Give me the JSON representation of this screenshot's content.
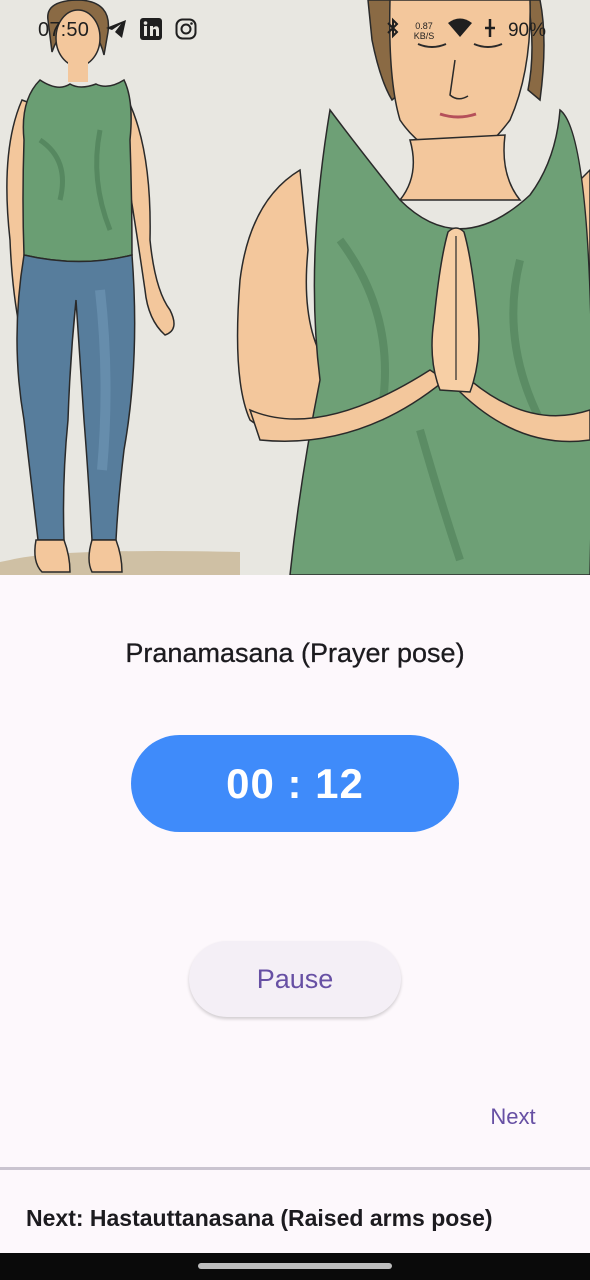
{
  "status_bar": {
    "time": "07:50",
    "app_icons": [
      "telegram-icon",
      "linkedin-icon",
      "instagram-icon"
    ],
    "net_speed_value": "0.87",
    "net_speed_unit": "KB/S",
    "battery": "90%"
  },
  "hero": {
    "image": "illustration-prayer-pose"
  },
  "exercise": {
    "title": "Pranamasana (Prayer pose)",
    "timer": "00 : 12"
  },
  "controls": {
    "pause_label": "Pause",
    "next_label": "Next"
  },
  "footer": {
    "next_pose_text": "Next: Hastauttanasana (Raised arms pose)"
  },
  "colors": {
    "background": "#fdf8fc",
    "timer_pill": "#3f8bfa",
    "accent_text": "#6750a4",
    "pause_button_bg": "#f4eff6"
  }
}
